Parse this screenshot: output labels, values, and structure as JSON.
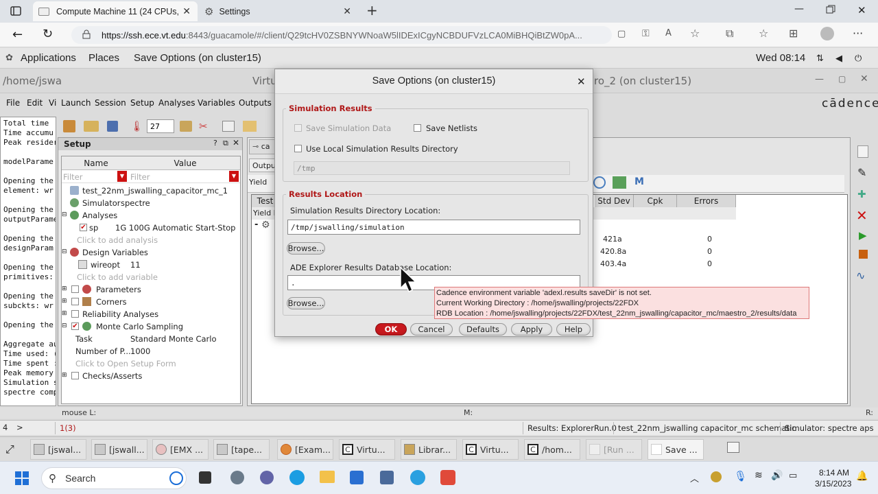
{
  "browser": {
    "active_tab_title": "Compute Machine 11 (24 CPUs, ...",
    "second_tab_title": "Settings",
    "url_host": "https://ssh.ece.vt.edu",
    "url_rest": ":8443/guacamole/#/client/Q29tcHV0ZSBNYWNoaW5lIDExICgyNCBDUFVzLCA0MiBHQiBtZW0pA..."
  },
  "gnome": {
    "applications": "Applications",
    "places": "Places",
    "active_window": "Save Options (on cluster15)",
    "clock": "Wed 08:14"
  },
  "virtuoso": {
    "title_left": "/home/jswa",
    "title_mid": "Virtu",
    "title_right": "ro_2 (on cluster15)",
    "menu": [
      "File",
      "Edit",
      "Vi",
      "Launch",
      "Session",
      "Setup",
      "Analyses",
      "Variables",
      "Outputs"
    ],
    "logo": "cādence",
    "log_lines": [
      "Total time",
      "Time accumu",
      "Peak resider",
      "",
      "modelParame",
      "",
      "Opening the",
      "element: wr",
      "",
      "Opening the",
      "outputParame",
      "",
      "Opening the",
      "designParam",
      "",
      "Opening the",
      "primitives:",
      "",
      "Opening the",
      "subckts: wr",
      "",
      "Opening the",
      "",
      "Aggregate au",
      "Time used: (",
      "Time spent :",
      "Peak memory",
      "Simulation s",
      "spectre comp"
    ],
    "toolbar_number": "27",
    "setup": {
      "title": "Setup",
      "col_name": "Name",
      "col_value": "Value",
      "filter": "Filter",
      "cell_name": "test_22nm_jswalling_capacitor_mc_1",
      "simulator_label": "Simulator",
      "simulator_value": "spectre",
      "analyses": "Analyses",
      "sp_label": "sp",
      "sp_value": "1G 100G Automatic Start-Stop",
      "add_analysis": "Click to add analysis",
      "design_variables": "Design Variables",
      "wireopt_label": "wireopt",
      "wireopt_value": "11",
      "add_variable": "Click to add variable",
      "parameters": "Parameters",
      "corners": "Corners",
      "reliability": "Reliability Analyses",
      "monte_carlo": "Monte Carlo Sampling",
      "task_label": "Task",
      "task_value": "Standard Monte Carlo",
      "numpoints_label": "Number of P...",
      "numpoints_value": "1000",
      "open_setup": "Click to Open Setup Form",
      "checks": "Checks/Asserts"
    },
    "outputs": {
      "tab_label": "ca",
      "outputs_label": "Outpu",
      "yield_label": "Yield",
      "test_col": "Test",
      "yield_est": "Yield E",
      "columns": [
        "Std Dev",
        "Cpk",
        "Errors"
      ],
      "rows": [
        {
          "std_dev": "421a",
          "errors": "0"
        },
        {
          "std_dev": "420.8a",
          "errors": "0"
        },
        {
          "std_dev": "403.4a",
          "errors": "0"
        }
      ]
    },
    "status": {
      "mouse_l": "mouse L:",
      "mouse_m": "M:",
      "mouse_r": "R:",
      "num": "4",
      "prompt": ">",
      "counter": "1(3)",
      "results": "Results: ExplorerRun.0",
      "cell": "test_22nm_jswalling capacitor_mc schematic",
      "simulator": "Simulator: spectre aps"
    }
  },
  "dialog": {
    "title": "Save Options (on cluster15)",
    "sim_results_group": "Simulation Results",
    "save_sim_data": "Save Simulation Data",
    "save_netlists": "Save Netlists",
    "use_local_dir": "Use Local Simulation Results Directory",
    "local_dir_value": "/tmp",
    "results_location_group": "Results Location",
    "sim_dir_label": "Simulation Results Directory Location:",
    "sim_dir_value": "/tmp/jswalling/simulation",
    "browse": "Browse...",
    "db_label": "ADE Explorer Results Database Location:",
    "db_value": ".",
    "ok": "OK",
    "cancel": "Cancel",
    "defaults": "Defaults",
    "apply": "Apply",
    "help": "Help"
  },
  "tooltip": {
    "line1": "Cadence environment variable 'adexl.results saveDir' is not set.",
    "line2": "Current Working Directory : /home/jswalling/projects/22FDX",
    "line3": "RDB Location : /home/jswalling/projects/22FDX/test_22nm_jswalling/capacitor_mc/maestro_2/results/data"
  },
  "remote_taskbar": [
    "[jswal...",
    "[jswall...",
    "[EMX ...",
    "[tape...",
    "[Exam...",
    "Virtu...",
    "Librar...",
    "Virtu...",
    "/hom...",
    "[Run ...",
    "Save ..."
  ],
  "windows": {
    "search": "Search",
    "time": "8:14 AM",
    "date": "3/15/2023"
  },
  "colors": {
    "accent_red": "#b01818",
    "ok_button": "#c8191e",
    "tooltip_bg": "#fbe0e0"
  }
}
